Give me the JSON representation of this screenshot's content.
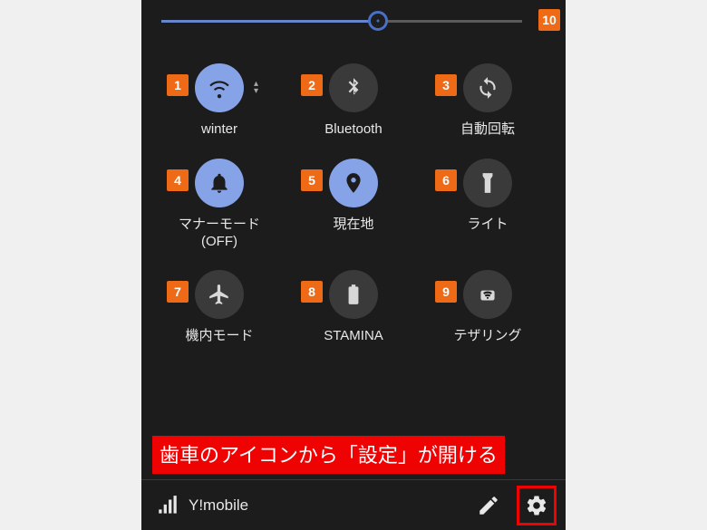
{
  "brightness": {
    "percent": 60,
    "badge": "10"
  },
  "tiles": [
    {
      "badge": "1",
      "label": "winter",
      "icon": "wifi",
      "on": true,
      "expandable": true
    },
    {
      "badge": "2",
      "label": "Bluetooth",
      "icon": "bluetooth",
      "on": false,
      "expandable": false
    },
    {
      "badge": "3",
      "label": "自動回転",
      "icon": "rotate",
      "on": false,
      "expandable": false
    },
    {
      "badge": "4",
      "label": "マナーモード\n(OFF)",
      "icon": "bell",
      "on": true,
      "expandable": false
    },
    {
      "badge": "5",
      "label": "現在地",
      "icon": "location",
      "on": true,
      "expandable": false
    },
    {
      "badge": "6",
      "label": "ライト",
      "icon": "flashlight",
      "on": false,
      "expandable": false
    },
    {
      "badge": "7",
      "label": "機内モード",
      "icon": "airplane",
      "on": false,
      "expandable": false
    },
    {
      "badge": "8",
      "label": "STAMINA",
      "icon": "battery",
      "on": false,
      "expandable": false
    },
    {
      "badge": "9",
      "label": "テザリング",
      "icon": "hotspot",
      "on": false,
      "expandable": false
    }
  ],
  "caption": "歯車のアイコンから「設定」が開ける",
  "footer": {
    "carrier": "Y!mobile"
  }
}
